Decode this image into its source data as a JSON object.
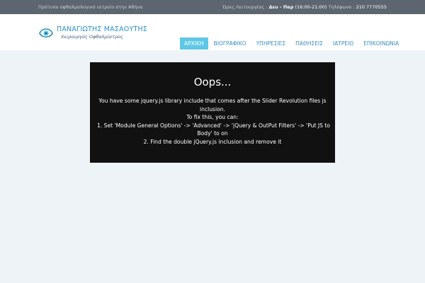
{
  "topbar": {
    "tagline": "Πρότυπο οφθαλμολογικό ιατρείο στην Αθήνα",
    "hours_label": "Ώρες Λειτουργίας :",
    "hours_days": "Δευ - Παρ",
    "hours_time": "(16:00-21:00)",
    "phone_label": "Τηλέφωνο :",
    "phone_number": "210 7770555"
  },
  "logo": {
    "icon": "eye-logo-icon",
    "name": "ΠΑΝΑΓΙΩΤΗΣ ΜΑΣΑΟΥΤΗΣ",
    "subtitle": "Χειρουργός Οφθαλμίατρος"
  },
  "nav": {
    "items": [
      {
        "label": "ΑΡΧΙΚΗ"
      },
      {
        "label": "ΒΙΟΓΡΑΦΙΚΟ"
      },
      {
        "label": "ΥΠΗΡΕΣΙΕΣ"
      },
      {
        "label": "ΠΑΘΗΣΕΙΣ"
      },
      {
        "label": "ΙΑΤΡΕΙΟ"
      },
      {
        "label": "ΕΠΙΚΟΙΝΩΝΙΑ"
      }
    ]
  },
  "error": {
    "title": "Oops...",
    "lines": [
      "You have some jquery.js library include that comes after the Slider Revolution files js",
      "inclusion.",
      "To fix this, you can:",
      "1. Set 'Module General Options' -> 'Advanced' -> 'jQuery & OutPut Filters' -> 'Put JS to",
      "Body' to on",
      "2. Find the double jQuery.js inclusion and remove it"
    ]
  },
  "colors": {
    "topbar_bg": "#5d6570",
    "page_bg": "#eef3f7",
    "accent": "#5fc7e6",
    "link": "#3a8ec4",
    "error_bg": "#111111"
  }
}
